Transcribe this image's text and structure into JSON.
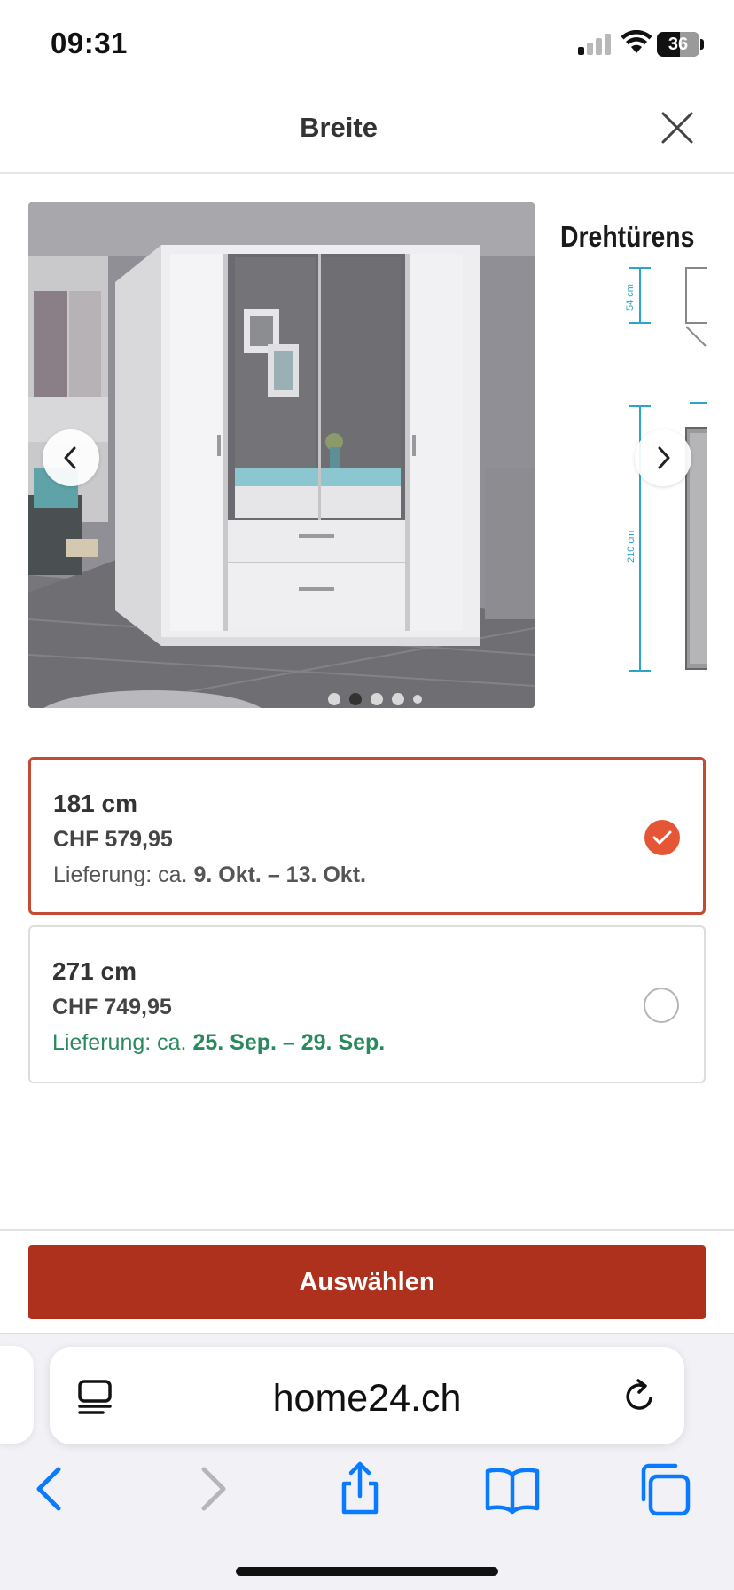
{
  "status_bar": {
    "time": "09:31",
    "battery": "36",
    "battery_level": 0.36,
    "signal_bars_active": 1
  },
  "header": {
    "title": "Breite",
    "close_icon": "close-icon"
  },
  "gallery": {
    "drawing_title": "Drehtürens",
    "dimension_labels": [
      "54 cm",
      "210 cm"
    ],
    "dots_count": 5,
    "active_dot": 1,
    "prev_icon": "chevron-left-icon",
    "next_icon": "chevron-right-icon"
  },
  "options": [
    {
      "size": "181 cm",
      "price": "CHF 579,95",
      "delivery_prefix": "Lieferung: ca.",
      "delivery_dates": "9. Okt. – 13. Okt.",
      "selected": true
    },
    {
      "size": "271 cm",
      "price": "CHF 749,95",
      "delivery_prefix": "Lieferung: ca.",
      "delivery_dates": "25. Sep. – 29. Sep.",
      "selected": false
    }
  ],
  "footer": {
    "select_label": "Auswählen"
  },
  "browser": {
    "url": "home24.ch",
    "reader_icon": "reader-mode-icon",
    "reload_icon": "reload-icon",
    "toolbar_icons": [
      "back-icon",
      "forward-icon",
      "share-icon",
      "bookmarks-icon",
      "tabs-icon"
    ]
  },
  "colors": {
    "accent": "#ad311c",
    "selected_border": "#c34b34",
    "check": "#e55637",
    "delivery_green": "#2a8a5e",
    "ios_blue": "#0a7aff"
  }
}
